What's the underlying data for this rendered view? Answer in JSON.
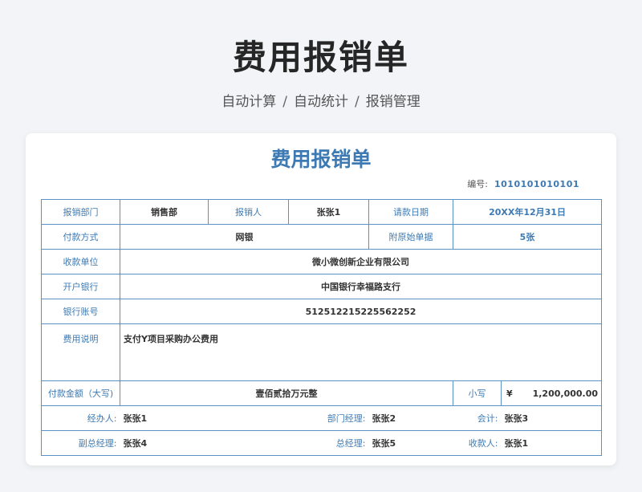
{
  "page": {
    "title": "费用报销单",
    "subtitle": [
      "自动计算",
      "自动统计",
      "报销管理"
    ],
    "subtitle_separator": "/"
  },
  "form": {
    "title": "费用报销单",
    "serial_label": "编号:",
    "serial_value": "1010101010101",
    "department_label": "报销部门",
    "department_value": "销售部",
    "claimant_label": "报销人",
    "claimant_value": "张张1",
    "request_date_label": "请款日期",
    "request_date_value": "20XX年12月31日",
    "payment_method_label": "付款方式",
    "payment_method_value": "网银",
    "attachments_label": "附原始单据",
    "attachments_value": "5张",
    "payee_label": "收款单位",
    "payee_value": "微小微创新企业有限公司",
    "bank_label": "开户银行",
    "bank_value": "中国银行幸福路支行",
    "account_label": "银行账号",
    "account_value": "512512215225562252",
    "description_label": "费用说明",
    "description_value": "支付Y项目采购办公费用",
    "amount_words_label": "付款金额（大写)",
    "amount_words_value": "壹佰贰拾万元整",
    "amount_small_label": "小写",
    "currency_symbol": "¥",
    "amount_small_value": "1,200,000.00",
    "handler_label": "经办人:",
    "handler_value": "张张1",
    "dept_manager_label": "部门经理:",
    "dept_manager_value": "张张2",
    "accountant_label": "会计:",
    "accountant_value": "张张3",
    "deputy_gm_label": "副总经理:",
    "deputy_gm_value": "张张4",
    "gm_label": "总经理:",
    "gm_value": "张张5",
    "receiver_label": "收款人:",
    "receiver_value": "张张1"
  },
  "colors": {
    "accent": "#3d7ab3",
    "border": "#5a92c6",
    "background": "#f2f4f7"
  }
}
